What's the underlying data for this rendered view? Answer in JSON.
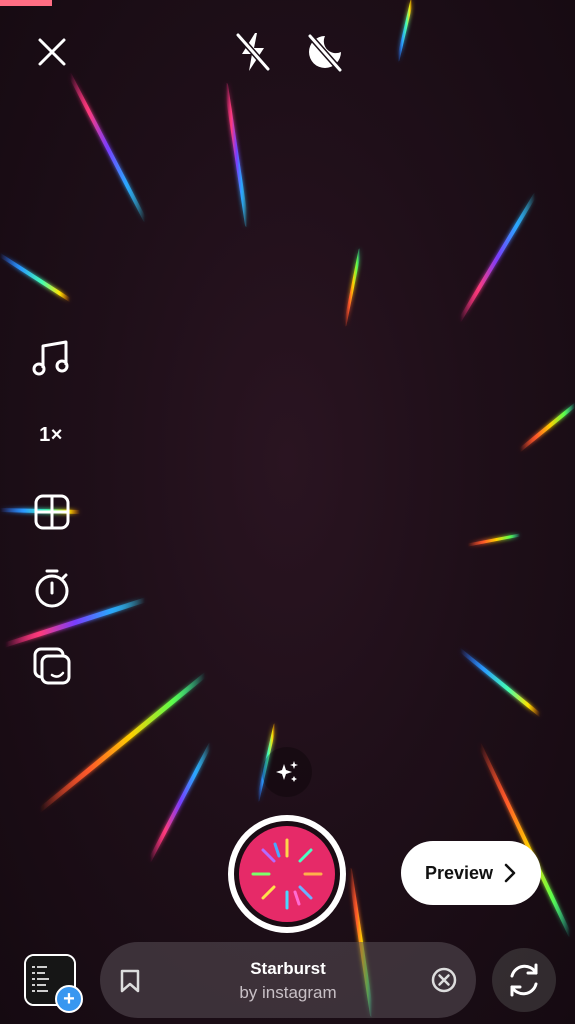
{
  "recording": {
    "progress_fraction": 0.09,
    "progress_color": "#ff6e84"
  },
  "top_bar": {
    "close_icon": "close-icon",
    "flash_icon": "flash-off-icon",
    "night_mode_icon": "night-mode-off-icon"
  },
  "side_tools": [
    {
      "name": "music",
      "icon": "music-note-icon"
    },
    {
      "name": "speed",
      "label": "1×"
    },
    {
      "name": "layout",
      "icon": "layout-grid-icon"
    },
    {
      "name": "timer",
      "icon": "timer-icon"
    },
    {
      "name": "dual",
      "icon": "dual-camera-icon"
    }
  ],
  "effects_button_icon": "sparkles-icon",
  "shutter": {
    "color": "#e62a68",
    "icon": "starburst-icon"
  },
  "preview_button": {
    "label": "Preview"
  },
  "effect": {
    "name": "Starburst",
    "author": "by instagram"
  },
  "gallery": {
    "icon": "gallery-thumbnail-icon",
    "badge": "+"
  },
  "flip_camera_icon": "flip-camera-icon",
  "accent_colors": {
    "brand": "#e62a68",
    "badge": "#3897f0"
  }
}
